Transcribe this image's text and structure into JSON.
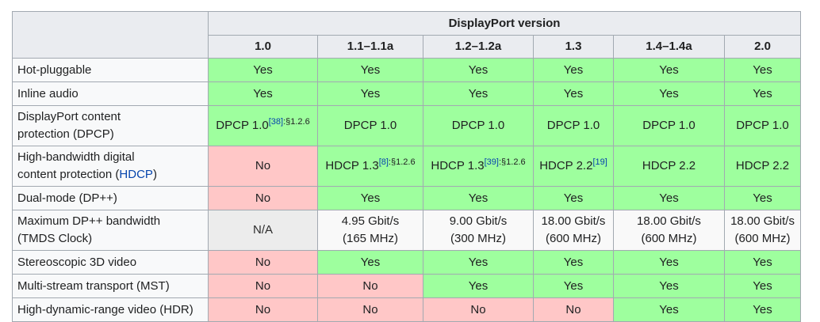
{
  "header": {
    "group_label": "DisplayPort version",
    "versions": [
      "1.0",
      "1.1–1.1a",
      "1.2–1.2a",
      "1.3",
      "1.4–1.4a",
      "2.0"
    ]
  },
  "rows": [
    {
      "label": "Hot-pluggable",
      "cells": [
        {
          "text": "Yes",
          "status": "yes"
        },
        {
          "text": "Yes",
          "status": "yes"
        },
        {
          "text": "Yes",
          "status": "yes"
        },
        {
          "text": "Yes",
          "status": "yes"
        },
        {
          "text": "Yes",
          "status": "yes"
        },
        {
          "text": "Yes",
          "status": "yes"
        }
      ]
    },
    {
      "label": "Inline audio",
      "cells": [
        {
          "text": "Yes",
          "status": "yes"
        },
        {
          "text": "Yes",
          "status": "yes"
        },
        {
          "text": "Yes",
          "status": "yes"
        },
        {
          "text": "Yes",
          "status": "yes"
        },
        {
          "text": "Yes",
          "status": "yes"
        },
        {
          "text": "Yes",
          "status": "yes"
        }
      ]
    },
    {
      "label_line1": "DisplayPort content",
      "label_line2": "protection (DPCP)",
      "cells": [
        {
          "text": "DPCP 1.0",
          "ref": "[38]",
          "sec": ":§1.2.6",
          "status": "yes"
        },
        {
          "text": "DPCP 1.0",
          "status": "yes"
        },
        {
          "text": "DPCP 1.0",
          "status": "yes"
        },
        {
          "text": "DPCP 1.0",
          "status": "yes"
        },
        {
          "text": "DPCP 1.0",
          "status": "yes"
        },
        {
          "text": "DPCP 1.0",
          "status": "yes"
        }
      ]
    },
    {
      "label_line1": "High-bandwidth digital",
      "label_line2_prefix": "content protection (",
      "label_line2_link": "HDCP",
      "label_line2_suffix": ")",
      "cells": [
        {
          "text": "No",
          "status": "no"
        },
        {
          "text": "HDCP 1.3",
          "ref": "[8]",
          "sec": ":§1.2.6",
          "status": "yes"
        },
        {
          "text": "HDCP 1.3",
          "ref": "[39]",
          "sec": ":§1.2.6",
          "status": "yes"
        },
        {
          "text": "HDCP 2.2",
          "ref": "[19]",
          "status": "yes"
        },
        {
          "text": "HDCP 2.2",
          "status": "yes"
        },
        {
          "text": "HDCP 2.2",
          "status": "yes"
        }
      ]
    },
    {
      "label": "Dual-mode (DP++)",
      "cells": [
        {
          "text": "No",
          "status": "no"
        },
        {
          "text": "Yes",
          "status": "yes"
        },
        {
          "text": "Yes",
          "status": "yes"
        },
        {
          "text": "Yes",
          "status": "yes"
        },
        {
          "text": "Yes",
          "status": "yes"
        },
        {
          "text": "Yes",
          "status": "yes"
        }
      ]
    },
    {
      "label_line1": "Maximum DP++ bandwidth",
      "label_line2": "(TMDS Clock)",
      "cells": [
        {
          "text": "N/A",
          "status": "na"
        },
        {
          "line1": "4.95 Gbit/s",
          "line2": "(165 MHz)",
          "status": "plain"
        },
        {
          "line1": "9.00 Gbit/s",
          "line2": "(300 MHz)",
          "status": "plain"
        },
        {
          "line1": "18.00 Gbit/s",
          "line2": "(600 MHz)",
          "status": "plain"
        },
        {
          "line1": "18.00 Gbit/s",
          "line2": "(600 MHz)",
          "status": "plain"
        },
        {
          "line1": "18.00 Gbit/s",
          "line2": "(600 MHz)",
          "status": "plain"
        }
      ]
    },
    {
      "label": "Stereoscopic 3D video",
      "cells": [
        {
          "text": "No",
          "status": "no"
        },
        {
          "text": "Yes",
          "status": "yes"
        },
        {
          "text": "Yes",
          "status": "yes"
        },
        {
          "text": "Yes",
          "status": "yes"
        },
        {
          "text": "Yes",
          "status": "yes"
        },
        {
          "text": "Yes",
          "status": "yes"
        }
      ]
    },
    {
      "label": "Multi-stream transport (MST)",
      "cells": [
        {
          "text": "No",
          "status": "no"
        },
        {
          "text": "No",
          "status": "no"
        },
        {
          "text": "Yes",
          "status": "yes"
        },
        {
          "text": "Yes",
          "status": "yes"
        },
        {
          "text": "Yes",
          "status": "yes"
        },
        {
          "text": "Yes",
          "status": "yes"
        }
      ]
    },
    {
      "label": "High-dynamic-range video (HDR)",
      "cells": [
        {
          "text": "No",
          "status": "no"
        },
        {
          "text": "No",
          "status": "no"
        },
        {
          "text": "No",
          "status": "no"
        },
        {
          "text": "No",
          "status": "no"
        },
        {
          "text": "Yes",
          "status": "yes"
        },
        {
          "text": "Yes",
          "status": "yes"
        }
      ]
    }
  ],
  "colors": {
    "yes": "#9eff9e",
    "no": "#ffc7c7",
    "na": "#ececec",
    "header": "#eaecf0",
    "border": "#a2a9b1",
    "link": "#0645ad"
  }
}
